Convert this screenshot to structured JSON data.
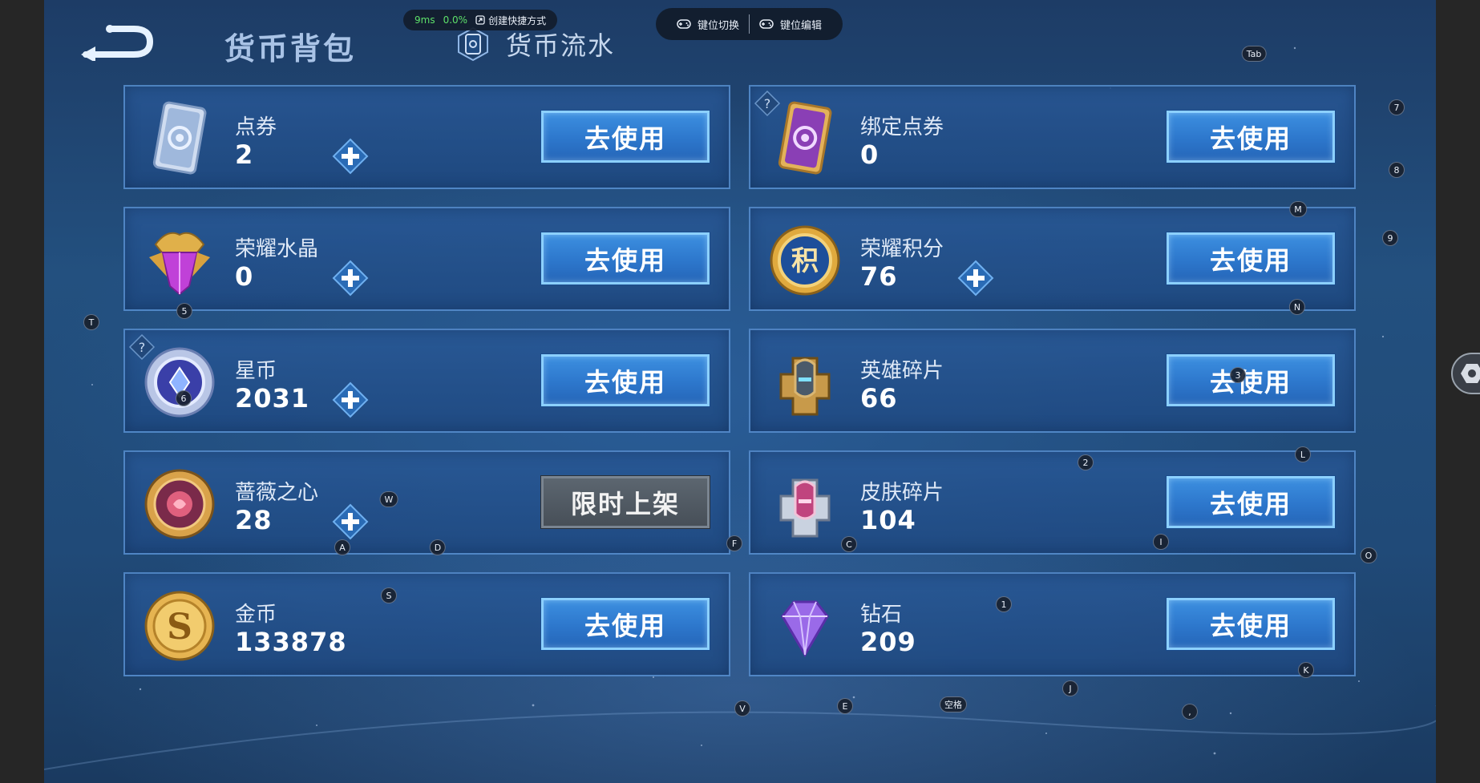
{
  "header": {
    "active_title": "货币背包",
    "tab_flow_label": "货币流水"
  },
  "overlay": {
    "ping": "9ms",
    "cpu": "0.0%",
    "create_shortcut": "创建快捷方式",
    "key_switch": "键位切换",
    "key_edit": "键位编辑"
  },
  "currencies": [
    {
      "name": "点券",
      "value": "2",
      "action": "去使用",
      "has_plus": true,
      "icon": "ticket-card-icon"
    },
    {
      "name": "绑定点券",
      "value": "0",
      "action": "去使用",
      "has_plus": false,
      "icon": "bound-ticket-card-icon"
    },
    {
      "name": "荣耀水晶",
      "value": "0",
      "action": "去使用",
      "has_plus": true,
      "icon": "glory-crystal-icon"
    },
    {
      "name": "荣耀积分",
      "value": "76",
      "action": "去使用",
      "has_plus": true,
      "icon": "glory-points-coin-icon"
    },
    {
      "name": "星币",
      "value": "2031",
      "action": "去使用",
      "has_plus": true,
      "icon": "star-coin-icon"
    },
    {
      "name": "英雄碎片",
      "value": "66",
      "action": "去使用",
      "has_plus": false,
      "icon": "hero-fragment-icon"
    },
    {
      "name": "蔷薇之心",
      "value": "28",
      "action": "限时上架",
      "has_plus": true,
      "icon": "rose-heart-icon"
    },
    {
      "name": "皮肤碎片",
      "value": "104",
      "action": "去使用",
      "has_plus": false,
      "icon": "skin-fragment-icon"
    },
    {
      "name": "金币",
      "value": "133878",
      "action": "去使用",
      "has_plus": false,
      "icon": "gold-coin-icon"
    },
    {
      "name": "钻石",
      "value": "209",
      "action": "去使用",
      "has_plus": false,
      "icon": "diamond-icon"
    }
  ],
  "keymap_labels": [
    "Tab",
    "7",
    "8",
    "M",
    "9",
    "N",
    "T",
    "5",
    "6",
    "3",
    "2",
    "L",
    "W",
    "A",
    "D",
    "F",
    "C",
    "I",
    "O",
    "S",
    "1",
    "K",
    "J",
    "V",
    "E",
    "空格",
    ","
  ],
  "colors": {
    "background": "#23507f",
    "button_blue": "#2d77cc",
    "button_border": "#8cd0ff",
    "limited_gray": "#474f58"
  }
}
